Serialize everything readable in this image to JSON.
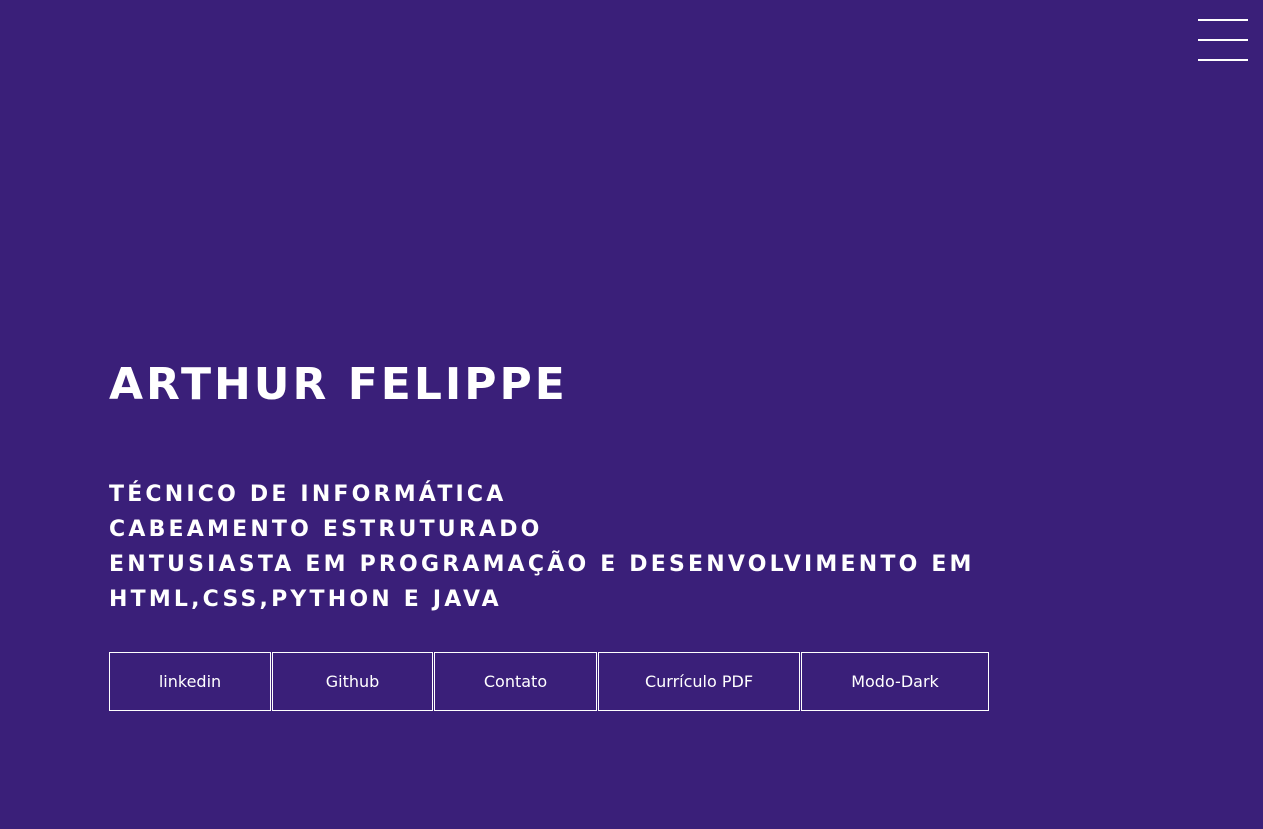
{
  "header": {
    "menu_icon": "hamburger-menu-icon"
  },
  "hero": {
    "name": "ARTHUR FELIPPE",
    "roles": [
      "TÉCNICO DE INFORMÁTICA",
      "CABEAMENTO ESTRUTURADO",
      "ENTUSIASTA EM PROGRAMAÇÃO E DESENVOLVIMENTO EM",
      "HTML,CSS,PYTHON E JAVA"
    ]
  },
  "buttons": [
    {
      "label": "linkedin"
    },
    {
      "label": "Github"
    },
    {
      "label": "Contato"
    },
    {
      "label": "Currículo PDF"
    },
    {
      "label": "Modo-Dark"
    }
  ],
  "colors": {
    "background": "#3a1f79",
    "text": "#ffffff",
    "border": "#ffffff"
  }
}
